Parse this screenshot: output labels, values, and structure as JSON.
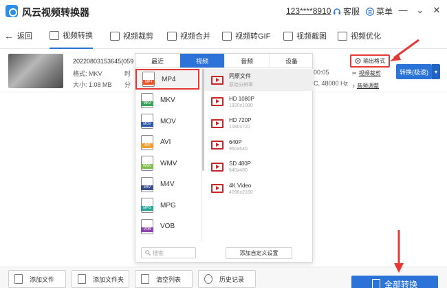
{
  "app": {
    "title": "风云视频转换器",
    "phone": "123****8910",
    "service": "客服",
    "menu": "菜单"
  },
  "nav": {
    "back": "返回",
    "items": [
      "视频转换",
      "视频裁剪",
      "视频合并",
      "视频转GIF",
      "视频截图",
      "视频优化"
    ]
  },
  "file": {
    "name": "20220803153645(059",
    "format_label": "格式: MKV",
    "size_label": "大小: 1.08 MB",
    "time_prefix": "时",
    "res_prefix": "分",
    "duration_tail": "00:05",
    "audio_tail": "C, 48000 Hz"
  },
  "right_panel": {
    "output_format": "输出格式",
    "video_crop": "视频裁剪",
    "audio_adjust": "音频调整",
    "convert": "转换(极速)"
  },
  "popup": {
    "tabs": [
      "最近",
      "视频",
      "音频",
      "设备"
    ],
    "formats": [
      {
        "label": "MP4",
        "tag": "MP4",
        "color": "#e8572a"
      },
      {
        "label": "MKV",
        "tag": "MKV",
        "color": "#3aa35b"
      },
      {
        "label": "MOV",
        "tag": "MOV",
        "color": "#2d5aa8"
      },
      {
        "label": "AVI",
        "tag": "AVI",
        "color": "#f0a030"
      },
      {
        "label": "WMV",
        "tag": "WMV",
        "color": "#7cc04b"
      },
      {
        "label": "M4V",
        "tag": "M4V",
        "color": "#3b4f8c"
      },
      {
        "label": "MPG",
        "tag": "MPG",
        "color": "#2aa59a"
      },
      {
        "label": "VOB",
        "tag": "VOB",
        "color": "#8e44ad"
      }
    ],
    "resolutions": [
      {
        "name": "同原文件",
        "sub": "原始分辨率"
      },
      {
        "name": "HD 1080P",
        "sub": "1920x1080"
      },
      {
        "name": "HD 720P",
        "sub": "1080x720"
      },
      {
        "name": "640P",
        "sub": "960x640"
      },
      {
        "name": "SD 480P",
        "sub": "640x480"
      },
      {
        "name": "4K Video",
        "sub": "4096x2160"
      }
    ],
    "search_placeholder": "搜索",
    "add_custom": "添加自定义设置"
  },
  "bottom": {
    "add_file": "添加文件",
    "add_folder": "添加文件夹",
    "clear_list": "清空列表",
    "history": "历史记录",
    "convert_all": "全部转换"
  },
  "colors": {
    "accent": "#2b73d9",
    "highlight": "#e53935"
  }
}
